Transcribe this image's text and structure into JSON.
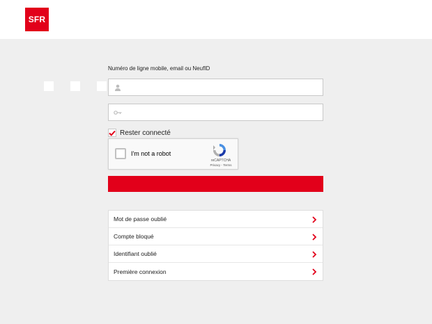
{
  "header": {
    "logo_text": "SFR",
    "brand_color": "#e2001a"
  },
  "login": {
    "label": "Numéro de ligne mobile, email ou NeufID",
    "username_icon": "user-icon",
    "username_value": "",
    "password_icon": "key-icon",
    "password_value": ""
  },
  "remember": {
    "label": "Rester connecté",
    "checked": true
  },
  "captcha": {
    "text": "I'm not a robot",
    "brand": "reCAPTCHA",
    "links": "Privacy - Terms"
  },
  "submit": {
    "label": ""
  },
  "links": [
    {
      "label": "Mot de passe oublié"
    },
    {
      "label": "Compte bloqué"
    },
    {
      "label": "Identifiant oublié"
    },
    {
      "label": "Première connexion"
    }
  ]
}
